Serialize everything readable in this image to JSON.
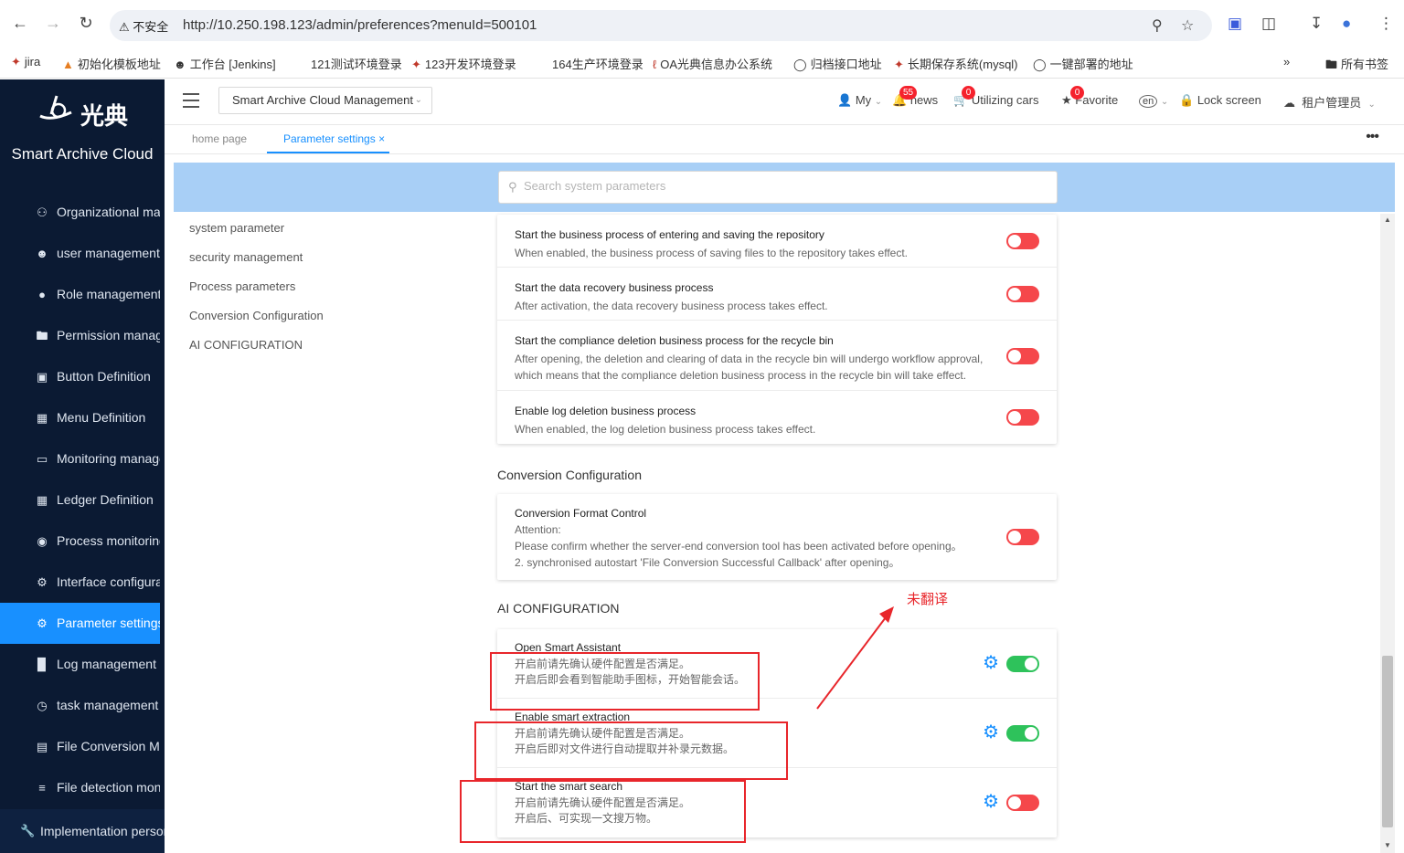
{
  "browser": {
    "url_warning": "不安全",
    "url": "http://10.250.198.123/admin/preferences?menuId=500101",
    "bookmarks": [
      "jira",
      "初始化模板地址",
      "工作台 [Jenkins]",
      "121测试环境登录",
      "123开发环境登录",
      "164生产环境登录",
      "OA光典信息办公系统",
      "归档接口地址",
      "长期保存系统(mysql)",
      "一键部署的地址"
    ],
    "all_bookmarks": "所有书签"
  },
  "sidebar": {
    "logo_text": "光典",
    "app_name": "Smart Archive Cloud",
    "items": [
      {
        "label": "Organizational management",
        "icon": "org-icon"
      },
      {
        "label": "user management",
        "icon": "user-icon"
      },
      {
        "label": "Role management",
        "icon": "role-icon"
      },
      {
        "label": "Permission management",
        "icon": "folder-icon"
      },
      {
        "label": "Button Definition",
        "icon": "button-icon"
      },
      {
        "label": "Menu Definition",
        "icon": "menu-grid-icon"
      },
      {
        "label": "Monitoring management",
        "icon": "monitor-icon"
      },
      {
        "label": "Ledger Definition",
        "icon": "ledger-icon"
      },
      {
        "label": "Process monitoring",
        "icon": "eye-icon"
      },
      {
        "label": "Interface configuration",
        "icon": "gear-icon"
      },
      {
        "label": "Parameter settings",
        "icon": "settings-icon"
      },
      {
        "label": "Log management",
        "icon": "bar-chart-icon"
      },
      {
        "label": "task management",
        "icon": "alarm-clock-icon"
      },
      {
        "label": "File Conversion Management",
        "icon": "file-convert-icon"
      },
      {
        "label": "File detection monitoring",
        "icon": "sliders-icon"
      }
    ],
    "active_index": 10,
    "implementation": "Implementation personnel"
  },
  "header": {
    "system_select": "Smart Archive Cloud Management",
    "my": "My",
    "news": "news",
    "news_count": "55",
    "cars": "Utilizing cars",
    "cars_count": "0",
    "favorite": "Favorite",
    "favorite_count": "0",
    "lang": "en",
    "lock": "Lock screen",
    "tenant": "租户管理员"
  },
  "tabs": [
    {
      "label": "home page"
    },
    {
      "label": "Parameter settings",
      "close": "×"
    }
  ],
  "search": {
    "placeholder": "Search system parameters"
  },
  "side_nav": [
    "system parameter",
    "security management",
    "Process parameters",
    "Conversion Configuration",
    "AI CONFIGURATION"
  ],
  "process_rows": [
    {
      "title": "Start the business process of entering and saving the repository",
      "desc": "When enabled, the business process of saving files to the repository takes effect.",
      "enabled": false
    },
    {
      "title": "Start the data recovery business process",
      "desc": "After activation, the data recovery business process takes effect.",
      "enabled": false
    },
    {
      "title": "Start the compliance deletion business process for the recycle bin",
      "desc": "After opening, the deletion and clearing of data in the recycle bin will undergo workflow approval, which means that the compliance deletion business process in the recycle bin will take effect.",
      "enabled": false
    },
    {
      "title": "Enable log deletion business process",
      "desc": "When enabled, the log deletion business process takes effect.",
      "enabled": false
    }
  ],
  "conversion": {
    "section_title": "Conversion Configuration",
    "title": "Conversion Format Control",
    "line1": "Attention:",
    "line2": "Please confirm whether the server-end conversion tool has been activated before opening。",
    "line3": "2. synchronised autostart 'File Conversion Successful Callback' after opening。",
    "enabled": false
  },
  "ai": {
    "section_title": "AI CONFIGURATION",
    "rows": [
      {
        "title": "Open Smart Assistant",
        "line1": "开启前请先确认硬件配置是否满足。",
        "line2": "开启后即会看到智能助手图标，开始智能会话。",
        "enabled": true
      },
      {
        "title": "Enable smart extraction",
        "line1": "开启前请先确认硬件配置是否满足。",
        "line2": "开启后即对文件进行自动提取并补录元数据。",
        "enabled": true
      },
      {
        "title": "Start the smart search",
        "line1": "开启前请先确认硬件配置是否满足。",
        "line2": "开启后、可实现一文搜万物。",
        "enabled": false
      }
    ]
  },
  "annotation": {
    "text": "未翻译"
  },
  "colors": {
    "sidebar_bg": "#0b1a33",
    "accent": "#1890ff",
    "toggle_off": "#f5474b",
    "toggle_on": "#2ec25b",
    "annotation": "#e8262b",
    "search_band": "#a8cff6"
  }
}
